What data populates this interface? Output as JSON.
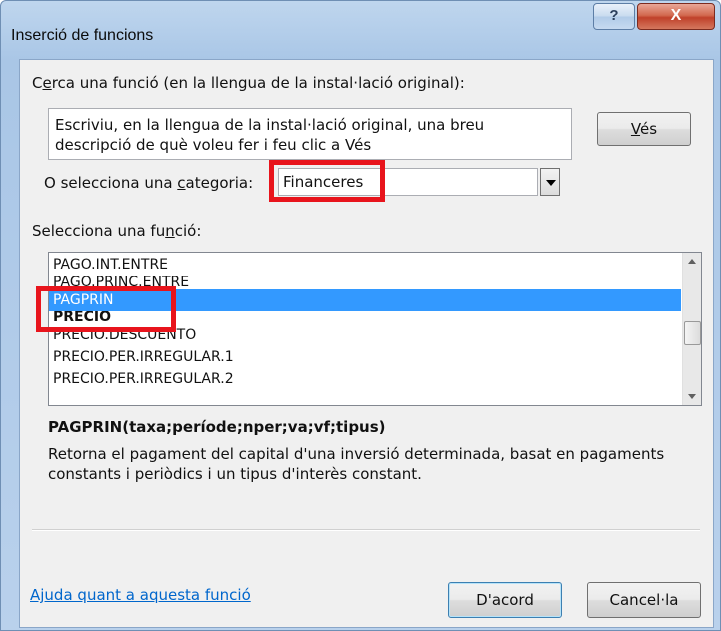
{
  "window": {
    "title": "Inserció de funcions",
    "help_glyph": "?",
    "close_glyph": "X"
  },
  "search": {
    "label_pre": "C",
    "label_u": "e",
    "label_post": "rca una funció (en la llengua de la instal·lació original):",
    "input_value": "Escriviu, en la llengua de la instal·lació original, una breu descripció de què voleu fer i feu clic a Vés",
    "go_u": "V",
    "go_post": "és"
  },
  "category": {
    "label_pre": "O selecciona una ",
    "label_u": "c",
    "label_post": "ategoria:",
    "selected": "Financeres"
  },
  "functions": {
    "label_pre": "Selecciona una fu",
    "label_u": "n",
    "label_post": "ció:",
    "items": [
      "PAGO.INT.ENTRE",
      "PAGO.PRINC.ENTRE",
      "PAGPRIN",
      "PRECIO",
      "PRECIO.DESCUENTO",
      "PRECIO.PER.IRREGULAR.1",
      "PRECIO.PER.IRREGULAR.2"
    ],
    "selected_index": 2
  },
  "details": {
    "signature": "PAGPRIN(taxa;període;nper;va;vf;tipus)",
    "description": "Retorna el pagament del capital d'una inversió determinada, basat en pagaments constants i periòdics i un tipus d'interès constant."
  },
  "footer": {
    "help_link": "Ajuda quant a aquesta funció",
    "ok": "D'acord",
    "cancel": "Cancel·la"
  },
  "colors": {
    "highlight": "#e8141c",
    "selection": "#3399ff"
  }
}
